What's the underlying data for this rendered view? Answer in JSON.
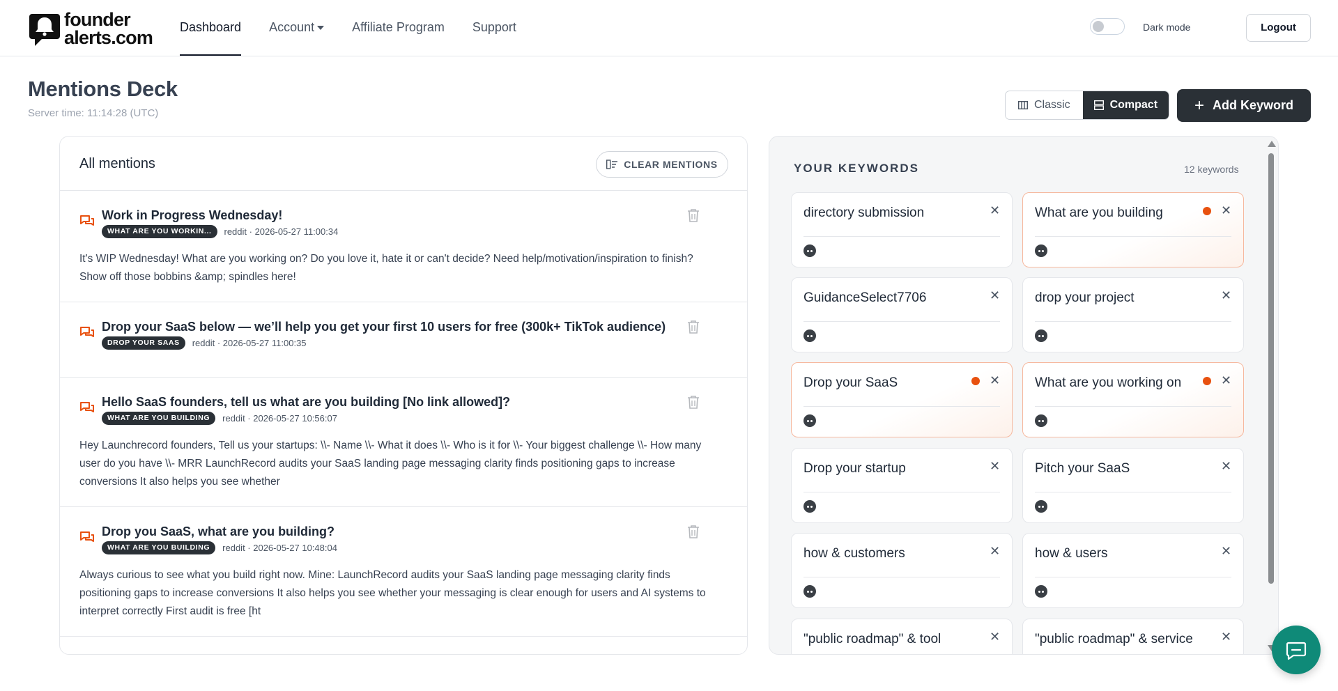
{
  "brand": {
    "line1": "founder",
    "line2": "alerts.com",
    "icon": "bell-chat-logo"
  },
  "nav": {
    "items": [
      {
        "label": "Dashboard",
        "active": true
      },
      {
        "label": "Account",
        "dropdown": true
      },
      {
        "label": "Affiliate Program"
      },
      {
        "label": "Support"
      }
    ],
    "dark_mode_label": "Dark mode",
    "dark_mode_on": false,
    "logout_label": "Logout"
  },
  "header": {
    "title": "Mentions Deck",
    "server_time": "Server time: 11:14:28 (UTC)",
    "view_classic": "Classic",
    "view_compact": "Compact",
    "active_view": "Compact",
    "add_keyword": "Add Keyword"
  },
  "mentions": {
    "title": "All mentions",
    "clear_label": "CLEAR MENTIONS",
    "items": [
      {
        "title": "Work in Progress Wednesday!",
        "tag": "WHAT ARE YOU WORKIN...",
        "source": "reddit · 2026-05-27 11:00:34",
        "body": "It's WIP Wednesday! What are you working on? Do you love it, hate it or can't decide? Need help/motivation/inspiration to finish? Show off those bobbins &amp; spindles here!"
      },
      {
        "title": "Drop your SaaS below — we’ll help you get your first 10 users for free (300k+ TikTok audience)",
        "tag": "DROP YOUR SAAS",
        "source": "reddit · 2026-05-27 11:00:35",
        "body": ""
      },
      {
        "title": "Hello SaaS founders, tell us what are you building [No link allowed]?",
        "tag": "WHAT ARE YOU BUILDING",
        "source": "reddit · 2026-05-27 10:56:07",
        "body": "Hey Launchrecord founders, Tell us your startups: \\\\- Name \\\\- What it does \\\\- Who is it for \\\\- Your biggest challenge \\\\- How many user do you have \\\\- MRR LaunchRecord audits your SaaS landing page messaging clarity finds positioning gaps to increase conversions It also helps you see whether"
      },
      {
        "title": "Drop you SaaS, what are you building?",
        "tag": "WHAT ARE YOU BUILDING",
        "source": "reddit · 2026-05-27 10:48:04",
        "body": "Always curious to see what you build right now. Mine: LaunchRecord audits your SaaS landing page messaging clarity finds positioning gaps to increase conversions It also helps you see whether your messaging is clear enough for users and AI systems to interpret correctly First audit is free [ht"
      }
    ]
  },
  "keywords": {
    "title": "YOUR KEYWORDS",
    "count": "12 keywords",
    "items": [
      {
        "name": "directory submission",
        "alert": false,
        "source": "reddit-icon"
      },
      {
        "name": "What are you building",
        "alert": true,
        "source": "reddit-icon"
      },
      {
        "name": "GuidanceSelect7706",
        "alert": false,
        "source": "reddit-icon"
      },
      {
        "name": "drop your project",
        "alert": false,
        "source": "reddit-icon"
      },
      {
        "name": "Drop your SaaS",
        "alert": true,
        "source": "reddit-icon"
      },
      {
        "name": "What are you working on",
        "alert": true,
        "source": "reddit-icon"
      },
      {
        "name": "Drop your startup",
        "alert": false,
        "source": "reddit-icon"
      },
      {
        "name": "Pitch your SaaS",
        "alert": false,
        "source": "reddit-icon"
      },
      {
        "name": "how & customers",
        "alert": false,
        "source": "reddit-icon"
      },
      {
        "name": "how & users",
        "alert": false,
        "source": "reddit-icon"
      },
      {
        "name": "\"public roadmap\" & tool",
        "alert": false,
        "source": "reddit-icon"
      },
      {
        "name": "\"public roadmap\" & service",
        "alert": false,
        "source": "reddit-icon"
      }
    ],
    "close_glyph": "✕"
  },
  "colors": {
    "accent_dark": "#2a3036",
    "alert_dot": "#e8510f",
    "mention_icon": "#e8510f",
    "chat": "#0f8a78"
  }
}
